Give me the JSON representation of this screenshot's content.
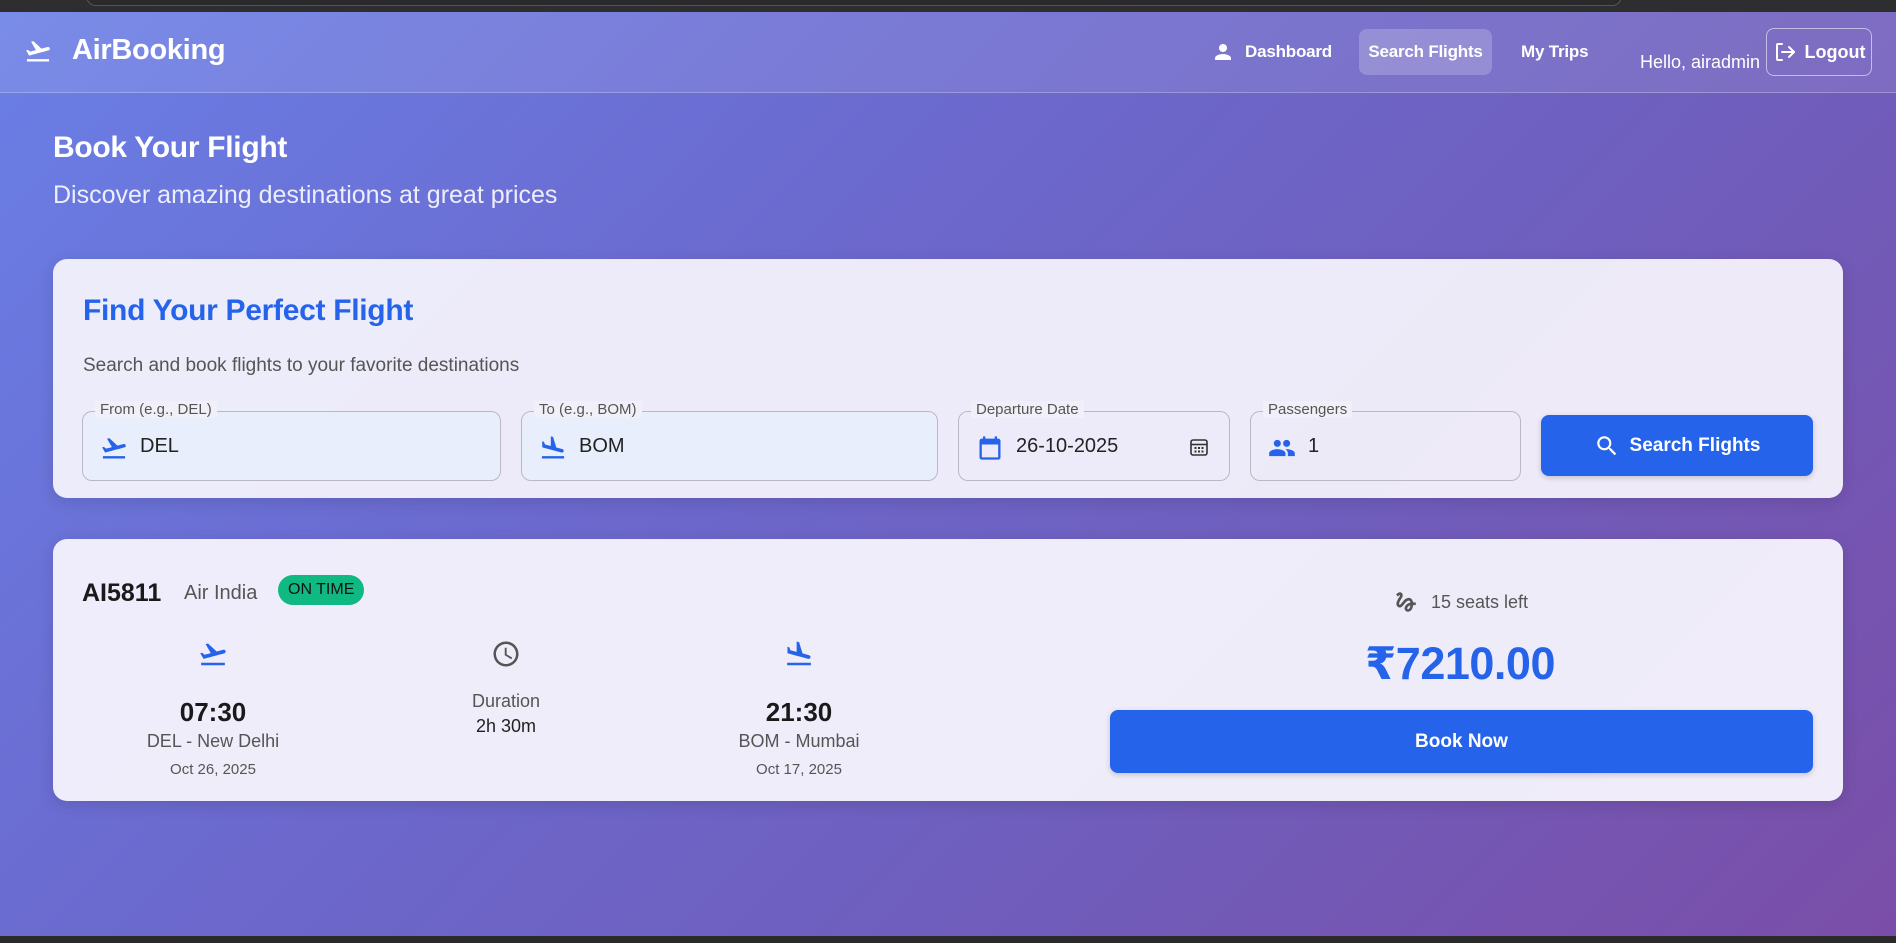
{
  "brand": {
    "name": "AirBooking"
  },
  "nav": {
    "dashboard": "Dashboard",
    "search_flights": "Search Flights",
    "my_trips": "My Trips",
    "greeting": "Hello, airadmin",
    "logout": "Logout"
  },
  "page": {
    "title": "Book Your Flight",
    "subtitle": "Discover amazing destinations at great prices"
  },
  "search": {
    "title": "Find Your Perfect Flight",
    "subtitle": "Search and book flights to your favorite destinations",
    "from_label": "From (e.g., DEL)",
    "from_value": "DEL",
    "to_label": "To (e.g., BOM)",
    "to_value": "BOM",
    "date_label": "Departure Date",
    "date_value": "26-10-2025",
    "passengers_label": "Passengers",
    "passengers_value": "1",
    "button": "Search Flights"
  },
  "flight": {
    "number": "AI5811",
    "airline": "Air India",
    "status": "ON TIME",
    "departure": {
      "time": "07:30",
      "place": "DEL - New Delhi",
      "date": "Oct 26, 2025"
    },
    "duration": {
      "label": "Duration",
      "value": "2h 30m"
    },
    "arrival": {
      "time": "21:30",
      "place": "BOM - Mumbai",
      "date": "Oct 17, 2025"
    },
    "seats": "15 seats left",
    "price": "₹7210.00",
    "book_button": "Book Now"
  },
  "colors": {
    "primary": "#2563eb",
    "status_green": "#10b981"
  },
  "icons": {
    "brand": "flight-takeoff-icon",
    "dashboard": "person-icon",
    "logout": "logout-icon",
    "from": "flight-takeoff-icon",
    "to": "flight-land-icon",
    "date": "calendar-icon",
    "passengers": "people-icon",
    "search": "search-icon",
    "seats": "seat-icon",
    "duration": "clock-icon"
  }
}
